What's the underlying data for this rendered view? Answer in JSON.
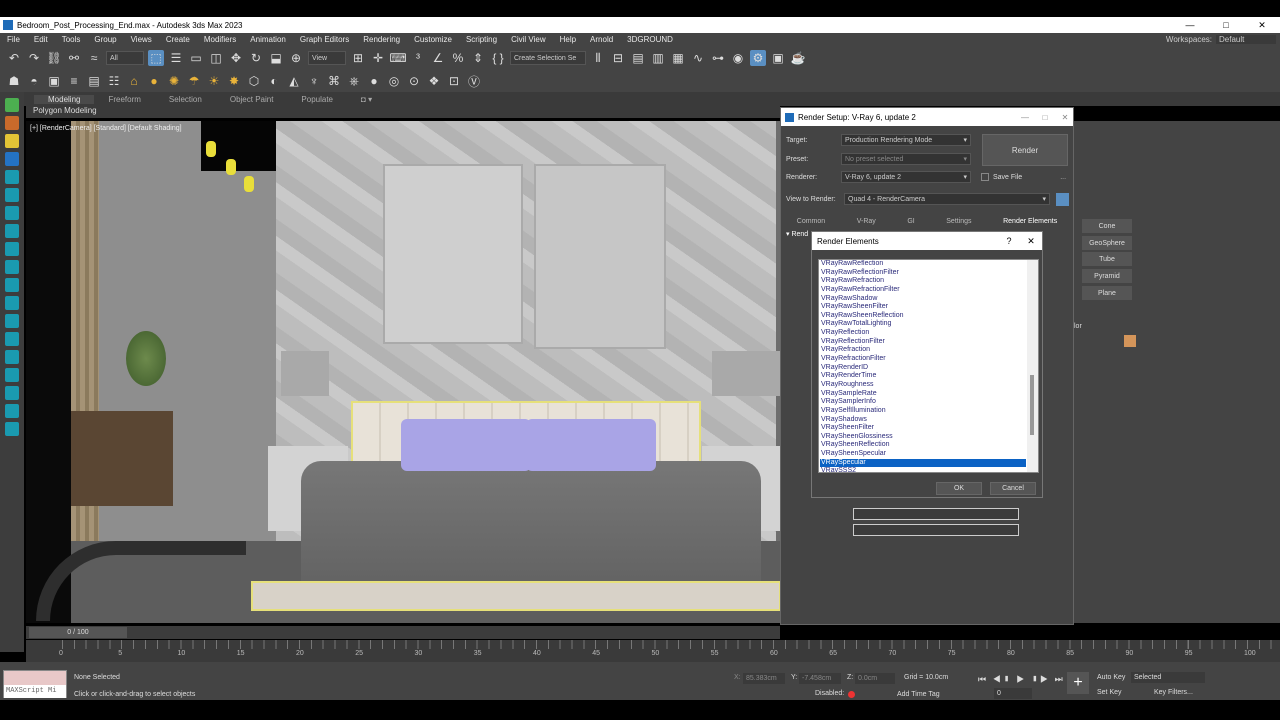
{
  "window": {
    "title": "Bedroom_Post_Processing_End.max - Autodesk 3ds Max 2023",
    "min": "—",
    "max": "□",
    "close": "✕"
  },
  "menu": [
    "File",
    "Edit",
    "Tools",
    "Group",
    "Views",
    "Create",
    "Modifiers",
    "Animation",
    "Graph Editors",
    "Rendering",
    "Customize",
    "Scripting",
    "Civil View",
    "Help",
    "Arnold",
    "3DGROUND"
  ],
  "workspaces": {
    "label": "Workspaces:",
    "value": "Default"
  },
  "toolbar": {
    "filter": "All",
    "view": "View",
    "selection_set": "Create Selection Se"
  },
  "ribbon": {
    "tabs": [
      "Modeling",
      "Freeform",
      "Selection",
      "Object Paint",
      "Populate"
    ],
    "sub": "Polygon Modeling"
  },
  "viewport": {
    "label": "[+] [RenderCamera] [Standard] [Default Shading]"
  },
  "render_setup": {
    "title": "Render Setup: V-Ray 6, update 2",
    "target_label": "Target:",
    "target": "Production Rendering Mode",
    "preset_label": "Preset:",
    "preset": "No preset selected",
    "renderer_label": "Renderer:",
    "renderer": "V-Ray 6, update 2",
    "save_file": "Save File",
    "view_label": "View to Render:",
    "view": "Quad 4 - RenderCamera",
    "render_button": "Render",
    "tabs": [
      "Common",
      "V-Ray",
      "GI",
      "Settings",
      "Render Elements"
    ],
    "rollout": "Rend"
  },
  "render_elements": {
    "title": "Render Elements",
    "help": "?",
    "close": "✕",
    "items": [
      "VRayRawReflection",
      "VRayRawReflectionFilter",
      "VRayRawRefraction",
      "VRayRawRefractionFilter",
      "VRayRawShadow",
      "VRayRawSheenFilter",
      "VRayRawSheenReflection",
      "VRayRawTotalLighting",
      "VRayReflection",
      "VRayReflectionFilter",
      "VRayRefraction",
      "VRayRefractionFilter",
      "VRayRenderID",
      "VRayRenderTime",
      "VRayRoughness",
      "VRaySampleRate",
      "VRaySamplerInfo",
      "VRaySelfIllumination",
      "VRayShadows",
      "VRaySheenFilter",
      "VRaySheenGlossiness",
      "VRaySheenReflection",
      "VRaySheenSpecular",
      "VRaySpecular",
      "VRaySSS2"
    ],
    "selected_index": 23,
    "ok": "OK",
    "cancel": "Cancel"
  },
  "command_panel": {
    "buttons": [
      "Cone",
      "GeoSphere",
      "Tube",
      "Pyramid",
      "Plane"
    ],
    "label": "lor",
    "swatch": "#d4955a"
  },
  "timeline": {
    "frame": "0 / 100",
    "ticks": [
      "0",
      "5",
      "10",
      "15",
      "20",
      "25",
      "30",
      "35",
      "40",
      "45",
      "50",
      "55",
      "60",
      "65",
      "70",
      "75",
      "80",
      "85",
      "90",
      "95",
      "100"
    ]
  },
  "status": {
    "maxscript": "MAXScript Mi",
    "none_selected": "None Selected",
    "hint": "Click or click-and-drag to select objects",
    "x_label": "X:",
    "x": "85.383cm",
    "y_label": "Y:",
    "y": "-7.458cm",
    "z_label": "Z:",
    "z": "0.0cm",
    "grid": "Grid = 10.0cm",
    "disabled": "Disabled:",
    "add_time_tag": "Add Time Tag",
    "auto_key": "Auto Key",
    "set_key": "Set Key",
    "selected": "Selected",
    "key_filters": "Key Filters...",
    "frame_field": "0"
  }
}
